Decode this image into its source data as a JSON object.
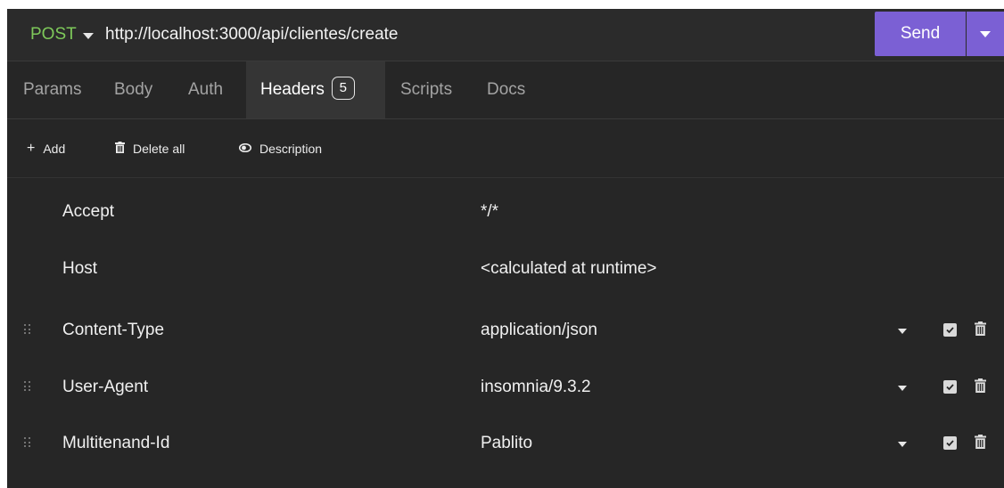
{
  "request": {
    "method": "POST",
    "url": "http://localhost:3000/api/clientes/create",
    "send_label": "Send"
  },
  "tabs": [
    {
      "label": "Params"
    },
    {
      "label": "Body"
    },
    {
      "label": "Auth"
    },
    {
      "label": "Headers",
      "badge": "5",
      "active": true
    },
    {
      "label": "Scripts"
    },
    {
      "label": "Docs"
    }
  ],
  "toolbar": {
    "add_label": "Add",
    "delete_all_label": "Delete all",
    "description_label": "Description"
  },
  "headers": [
    {
      "name": "Accept",
      "value": "*/*"
    },
    {
      "name": "Host",
      "value": "<calculated at runtime>"
    },
    {
      "name": "Content-Type",
      "value": "application/json"
    },
    {
      "name": "User-Agent",
      "value": "insomnia/9.3.2"
    },
    {
      "name": "Multitenand-Id",
      "value": "Pablito"
    }
  ],
  "colors": {
    "accent": "#7b60d4",
    "method_post": "#7ec95a",
    "background": "#262626"
  }
}
